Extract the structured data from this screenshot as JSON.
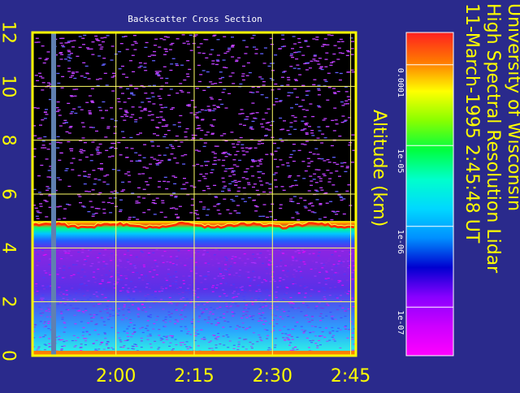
{
  "colors": {
    "background": "#2a2a8c",
    "frame": "#ffff00",
    "grid": "#ffff66",
    "label": "#ffff00",
    "title": "#ffffff",
    "plot_bg": "#000000"
  },
  "chart_data": {
    "type": "heatmap",
    "title": "Backscatter Cross Section",
    "header_lines": [
      "University of Wisconsin",
      "High Spectral Resolution Lidar",
      "11-March-1995   2:45:48 UT"
    ],
    "xlabel": "",
    "ylabel": "Altitude (km)",
    "x_ticks": [
      "2:00",
      "2:15",
      "2:30",
      "2:45"
    ],
    "x_tick_minutes": [
      120,
      135,
      150,
      165
    ],
    "xlim_minutes": [
      104,
      166
    ],
    "y_ticks": [
      "0",
      "2",
      "4",
      "6",
      "8",
      "10",
      "12"
    ],
    "y_tick_values": [
      0,
      2,
      4,
      6,
      8,
      10,
      12
    ],
    "ylim": [
      0,
      12
    ],
    "colorbar": {
      "labels": [
        "0.0001",
        "1e-05",
        "1e-06",
        "1e-07"
      ],
      "values": [
        0.0001,
        1e-05,
        1e-06,
        1e-07
      ],
      "scale": "log",
      "stops": [
        "#ff2020",
        "#ff7a00",
        "#ffff00",
        "#88ff00",
        "#00ff40",
        "#00ffcc",
        "#00d8ff",
        "#0090ff",
        "#0000d0",
        "#8800ff",
        "#cc00ff",
        "#ff00ff"
      ]
    },
    "cloud_layer_km": [
      4.5,
      5.0
    ],
    "grid": true
  }
}
